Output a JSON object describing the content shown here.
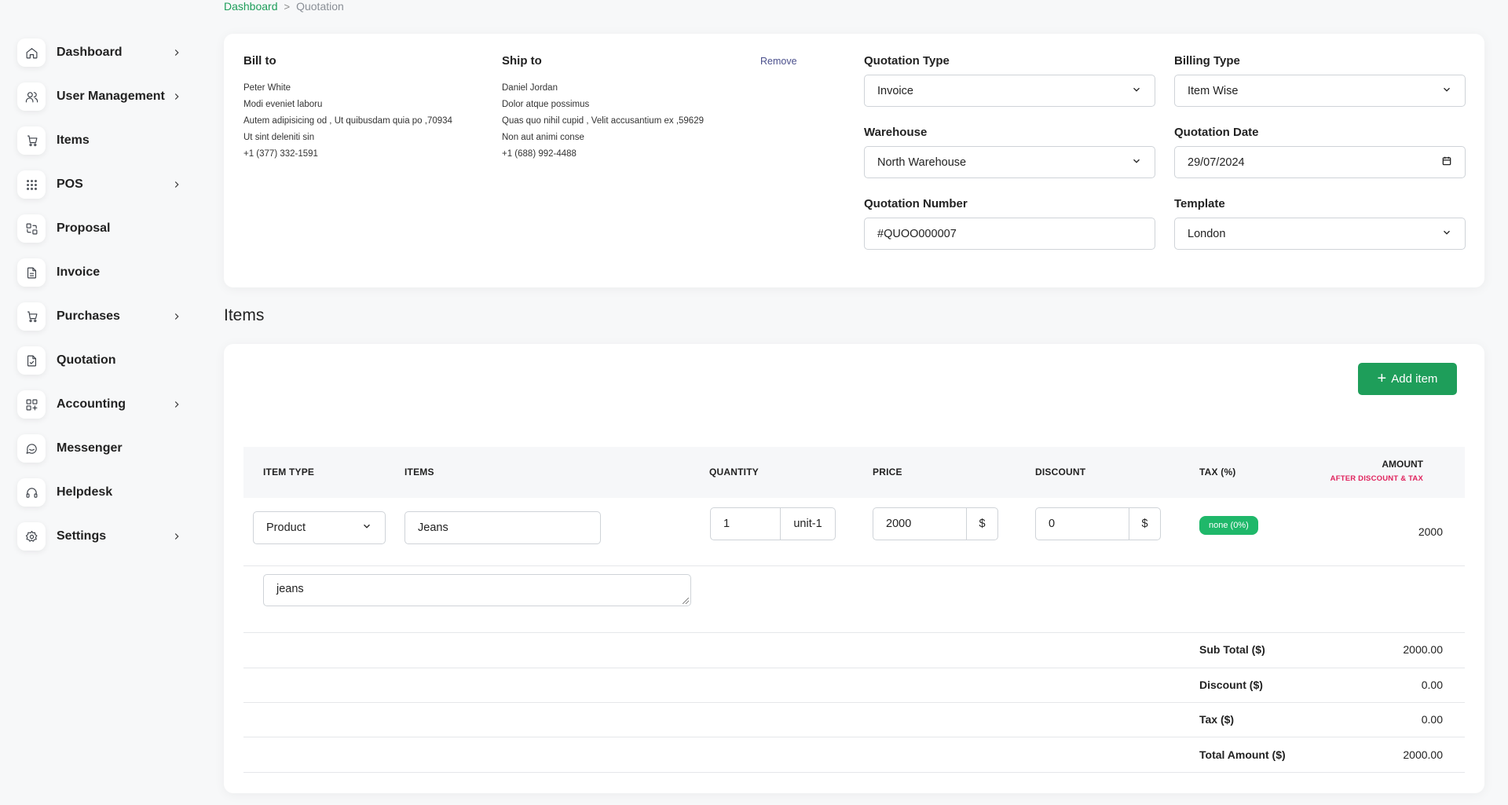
{
  "breadcrumb": {
    "home": "Dashboard",
    "separator": ">",
    "current": "Quotation"
  },
  "sidebar": {
    "items": [
      {
        "label": "Dashboard",
        "icon": "home-icon",
        "has_submenu": true
      },
      {
        "label": "User Management",
        "icon": "users-icon",
        "has_submenu": true
      },
      {
        "label": "Items",
        "icon": "cart-icon",
        "has_submenu": false
      },
      {
        "label": "POS",
        "icon": "grid-dots-icon",
        "has_submenu": true
      },
      {
        "label": "Proposal",
        "icon": "swap-icon",
        "has_submenu": false
      },
      {
        "label": "Invoice",
        "icon": "file-icon",
        "has_submenu": false
      },
      {
        "label": "Purchases",
        "icon": "cart-icon",
        "has_submenu": true
      },
      {
        "label": "Quotation",
        "icon": "file-check-icon",
        "has_submenu": false
      },
      {
        "label": "Accounting",
        "icon": "apps-icon",
        "has_submenu": true
      },
      {
        "label": "Messenger",
        "icon": "chat-icon",
        "has_submenu": false
      },
      {
        "label": "Helpdesk",
        "icon": "headphones-icon",
        "has_submenu": false
      },
      {
        "label": "Settings",
        "icon": "gear-icon",
        "has_submenu": true
      }
    ]
  },
  "bill_to": {
    "title": "Bill to",
    "name": "Peter White",
    "line1": "Modi eveniet laboru",
    "line2": "Autem adipisicing od , Ut quibusdam quia po ,70934",
    "line3": "Ut sint deleniti sin",
    "phone": "+1 (377) 332-1591"
  },
  "ship_to": {
    "title": "Ship to",
    "name": "Daniel Jordan",
    "line1": "Dolor atque possimus",
    "line2": "Quas quo nihil cupid , Velit accusantium ex ,59629",
    "line3": "Non aut animi conse",
    "phone": "+1 (688) 992-4488",
    "remove_label": "Remove"
  },
  "form": {
    "quotation_type": {
      "label": "Quotation Type",
      "value": "Invoice"
    },
    "billing_type": {
      "label": "Billing Type",
      "value": "Item Wise"
    },
    "warehouse": {
      "label": "Warehouse",
      "value": "North Warehouse"
    },
    "quotation_date": {
      "label": "Quotation Date",
      "value": "29/07/2024"
    },
    "quotation_number": {
      "label": "Quotation Number",
      "value": "#QUOO000007"
    },
    "template": {
      "label": "Template",
      "value": "London"
    }
  },
  "items_section": {
    "title": "Items",
    "add_button": "Add item",
    "columns": {
      "item_type": "ITEM TYPE",
      "items": "ITEMS",
      "quantity": "QUANTITY",
      "price": "PRICE",
      "discount": "DISCOUNT",
      "tax": "TAX (%)",
      "amount": "AMOUNT",
      "amount_sub": "AFTER DISCOUNT & TAX"
    },
    "row": {
      "item_type": "Product",
      "item": "Jeans",
      "quantity": "1",
      "unit": "unit-1",
      "price": "2000",
      "price_currency": "$",
      "discount": "0",
      "discount_currency": "$",
      "tax": "none (0%)",
      "amount": "2000",
      "description": "jeans"
    },
    "summary": {
      "subtotal_label": "Sub Total ($)",
      "subtotal": "2000.00",
      "discount_label": "Discount ($)",
      "discount": "0.00",
      "tax_label": "Tax ($)",
      "tax": "0.00",
      "total_label": "Total Amount ($)",
      "total": "2000.00"
    }
  },
  "colors": {
    "accent": "#1e9e5a",
    "tax_badge": "#1fb86a",
    "amount_sub": "#e0245e"
  }
}
